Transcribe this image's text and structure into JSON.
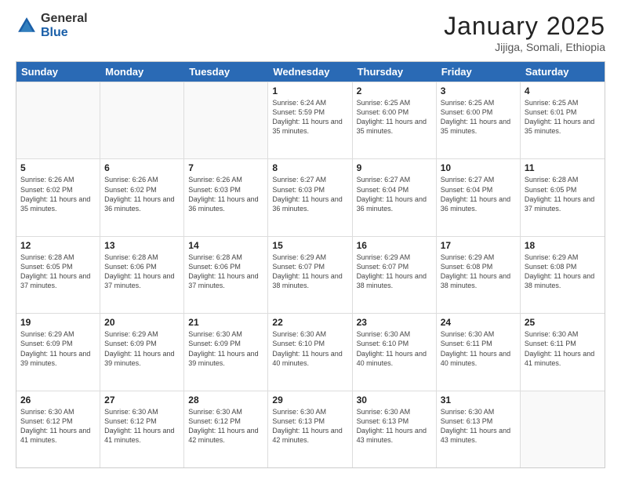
{
  "logo": {
    "general": "General",
    "blue": "Blue"
  },
  "title": "January 2025",
  "location": "Jijiga, Somali, Ethiopia",
  "days": [
    "Sunday",
    "Monday",
    "Tuesday",
    "Wednesday",
    "Thursday",
    "Friday",
    "Saturday"
  ],
  "weeks": [
    [
      {
        "day": "",
        "info": ""
      },
      {
        "day": "",
        "info": ""
      },
      {
        "day": "",
        "info": ""
      },
      {
        "day": "1",
        "info": "Sunrise: 6:24 AM\nSunset: 5:59 PM\nDaylight: 11 hours and 35 minutes."
      },
      {
        "day": "2",
        "info": "Sunrise: 6:25 AM\nSunset: 6:00 PM\nDaylight: 11 hours and 35 minutes."
      },
      {
        "day": "3",
        "info": "Sunrise: 6:25 AM\nSunset: 6:00 PM\nDaylight: 11 hours and 35 minutes."
      },
      {
        "day": "4",
        "info": "Sunrise: 6:25 AM\nSunset: 6:01 PM\nDaylight: 11 hours and 35 minutes."
      }
    ],
    [
      {
        "day": "5",
        "info": "Sunrise: 6:26 AM\nSunset: 6:02 PM\nDaylight: 11 hours and 35 minutes."
      },
      {
        "day": "6",
        "info": "Sunrise: 6:26 AM\nSunset: 6:02 PM\nDaylight: 11 hours and 36 minutes."
      },
      {
        "day": "7",
        "info": "Sunrise: 6:26 AM\nSunset: 6:03 PM\nDaylight: 11 hours and 36 minutes."
      },
      {
        "day": "8",
        "info": "Sunrise: 6:27 AM\nSunset: 6:03 PM\nDaylight: 11 hours and 36 minutes."
      },
      {
        "day": "9",
        "info": "Sunrise: 6:27 AM\nSunset: 6:04 PM\nDaylight: 11 hours and 36 minutes."
      },
      {
        "day": "10",
        "info": "Sunrise: 6:27 AM\nSunset: 6:04 PM\nDaylight: 11 hours and 36 minutes."
      },
      {
        "day": "11",
        "info": "Sunrise: 6:28 AM\nSunset: 6:05 PM\nDaylight: 11 hours and 37 minutes."
      }
    ],
    [
      {
        "day": "12",
        "info": "Sunrise: 6:28 AM\nSunset: 6:05 PM\nDaylight: 11 hours and 37 minutes."
      },
      {
        "day": "13",
        "info": "Sunrise: 6:28 AM\nSunset: 6:06 PM\nDaylight: 11 hours and 37 minutes."
      },
      {
        "day": "14",
        "info": "Sunrise: 6:28 AM\nSunset: 6:06 PM\nDaylight: 11 hours and 37 minutes."
      },
      {
        "day": "15",
        "info": "Sunrise: 6:29 AM\nSunset: 6:07 PM\nDaylight: 11 hours and 38 minutes."
      },
      {
        "day": "16",
        "info": "Sunrise: 6:29 AM\nSunset: 6:07 PM\nDaylight: 11 hours and 38 minutes."
      },
      {
        "day": "17",
        "info": "Sunrise: 6:29 AM\nSunset: 6:08 PM\nDaylight: 11 hours and 38 minutes."
      },
      {
        "day": "18",
        "info": "Sunrise: 6:29 AM\nSunset: 6:08 PM\nDaylight: 11 hours and 38 minutes."
      }
    ],
    [
      {
        "day": "19",
        "info": "Sunrise: 6:29 AM\nSunset: 6:09 PM\nDaylight: 11 hours and 39 minutes."
      },
      {
        "day": "20",
        "info": "Sunrise: 6:29 AM\nSunset: 6:09 PM\nDaylight: 11 hours and 39 minutes."
      },
      {
        "day": "21",
        "info": "Sunrise: 6:30 AM\nSunset: 6:09 PM\nDaylight: 11 hours and 39 minutes."
      },
      {
        "day": "22",
        "info": "Sunrise: 6:30 AM\nSunset: 6:10 PM\nDaylight: 11 hours and 40 minutes."
      },
      {
        "day": "23",
        "info": "Sunrise: 6:30 AM\nSunset: 6:10 PM\nDaylight: 11 hours and 40 minutes."
      },
      {
        "day": "24",
        "info": "Sunrise: 6:30 AM\nSunset: 6:11 PM\nDaylight: 11 hours and 40 minutes."
      },
      {
        "day": "25",
        "info": "Sunrise: 6:30 AM\nSunset: 6:11 PM\nDaylight: 11 hours and 41 minutes."
      }
    ],
    [
      {
        "day": "26",
        "info": "Sunrise: 6:30 AM\nSunset: 6:12 PM\nDaylight: 11 hours and 41 minutes."
      },
      {
        "day": "27",
        "info": "Sunrise: 6:30 AM\nSunset: 6:12 PM\nDaylight: 11 hours and 41 minutes."
      },
      {
        "day": "28",
        "info": "Sunrise: 6:30 AM\nSunset: 6:12 PM\nDaylight: 11 hours and 42 minutes."
      },
      {
        "day": "29",
        "info": "Sunrise: 6:30 AM\nSunset: 6:13 PM\nDaylight: 11 hours and 42 minutes."
      },
      {
        "day": "30",
        "info": "Sunrise: 6:30 AM\nSunset: 6:13 PM\nDaylight: 11 hours and 43 minutes."
      },
      {
        "day": "31",
        "info": "Sunrise: 6:30 AM\nSunset: 6:13 PM\nDaylight: 11 hours and 43 minutes."
      },
      {
        "day": "",
        "info": ""
      }
    ]
  ]
}
